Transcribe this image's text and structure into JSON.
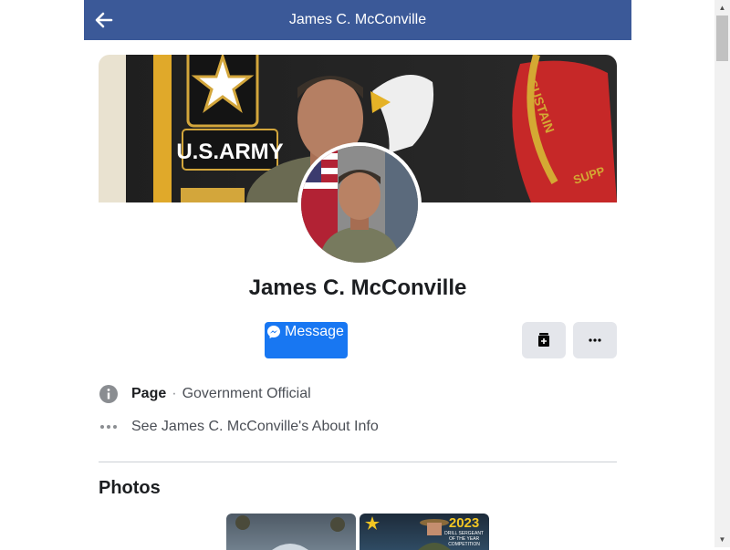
{
  "header": {
    "title": "James C. McConville"
  },
  "profile": {
    "name": "James C. McConville"
  },
  "cover": {
    "army_text": "U.S.ARMY",
    "patch_text_1": "SUSTAIN",
    "patch_text_2": "SUPP"
  },
  "actions": {
    "message_label": "Message"
  },
  "info": {
    "page_label": "Page",
    "separator": "·",
    "category": "Government Official",
    "about_link": "See James C. McConville's About Info"
  },
  "photos": {
    "title": "Photos",
    "thumb2_year": "2023",
    "thumb2_caption_1": "DRILL SERGEANT",
    "thumb2_caption_2": "OF THE YEAR",
    "thumb2_caption_3": "COMPETITION"
  },
  "colors": {
    "header_bg": "#3b5998",
    "primary_button": "#1877f2",
    "secondary_button": "#e4e6eb"
  },
  "icons": {
    "back": "arrow-left-icon",
    "messenger": "messenger-icon",
    "save": "save-icon",
    "more": "more-icon",
    "info": "info-icon",
    "ellipsis": "ellipsis-icon"
  }
}
